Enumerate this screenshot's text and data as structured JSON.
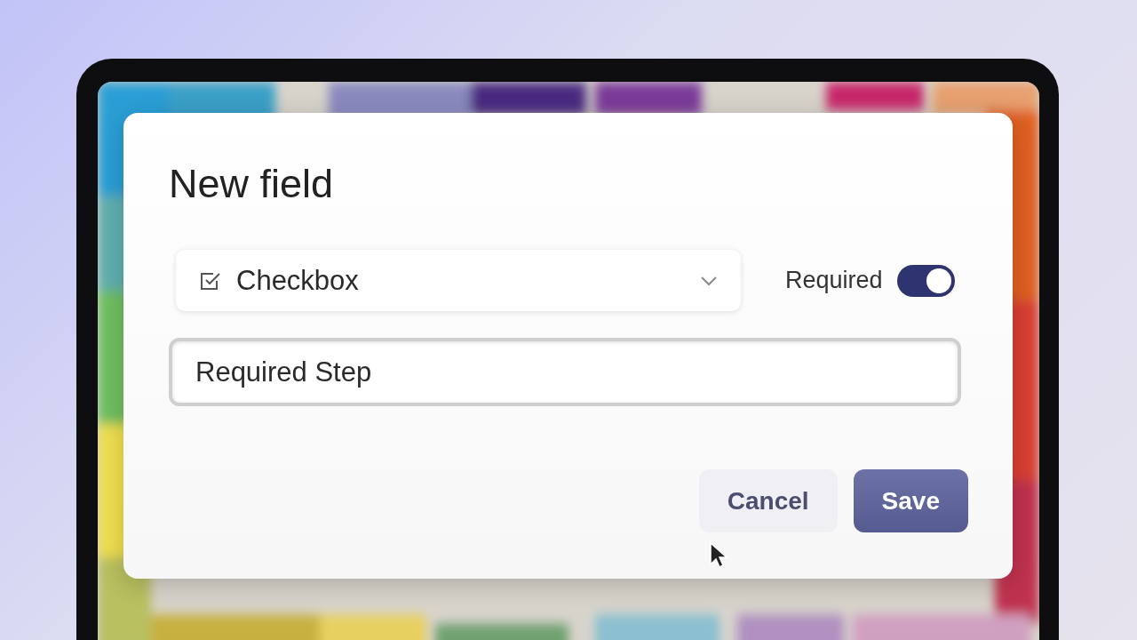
{
  "dialog": {
    "title": "New field",
    "field_type": {
      "value": "Checkbox"
    },
    "required": {
      "label": "Required",
      "on": true
    },
    "name_field": {
      "value": "Required Step"
    },
    "buttons": [
      {
        "label": "Cancel",
        "kind": "secondary"
      },
      {
        "label": "Save",
        "kind": "primary"
      }
    ]
  }
}
